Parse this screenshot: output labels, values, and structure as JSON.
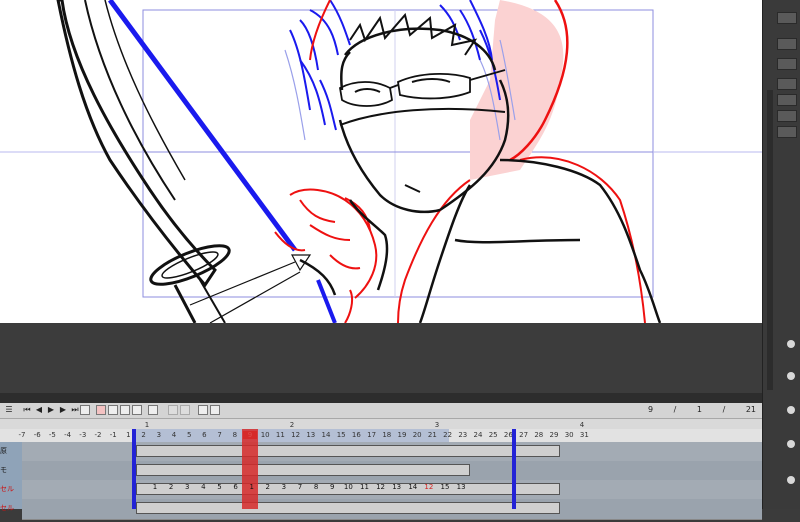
{
  "timeline": {
    "frame_info": {
      "current": "9",
      "sep1": "/",
      "val2": "1",
      "sep2": "/",
      "total": "21"
    },
    "ruler_labels": [
      "-7",
      "-6",
      "-5",
      "-4",
      "-3",
      "-2",
      "-1",
      "1",
      "2",
      "3",
      "4",
      "5",
      "6",
      "7",
      "8",
      "9",
      "10",
      "11",
      "12",
      "13",
      "14",
      "15",
      "16",
      "17",
      "18",
      "19",
      "20",
      "21",
      "22",
      "23",
      "24",
      "25",
      "26",
      "27",
      "28",
      "29",
      "30",
      "31"
    ],
    "ruler_top_marks": [
      "1",
      "2",
      "3",
      "4"
    ],
    "current_frame": "9",
    "tracks": [
      {
        "label": "原",
        "color": "#1b1b1b"
      },
      {
        "label": "モ",
        "color": "#1b1b1b"
      },
      {
        "label": "セル",
        "color": "#cc1111"
      },
      {
        "label": "セル",
        "color": "#cc1111"
      }
    ],
    "cell_numbers": [
      "1",
      "2",
      "3",
      "4",
      "5",
      "6",
      "1",
      "2",
      "3",
      "7",
      "8",
      "9",
      "10",
      "11",
      "12",
      "13",
      "14",
      "12",
      "15",
      "13"
    ]
  },
  "colors": {
    "canvas_bg": "#ffffff",
    "panel_bg": "#3c3c3c",
    "blue_stroke": "#1a1aee",
    "red_stroke": "#ee1111",
    "current_frame_red": "#d62a2a",
    "marker_blue": "#2323d6"
  }
}
